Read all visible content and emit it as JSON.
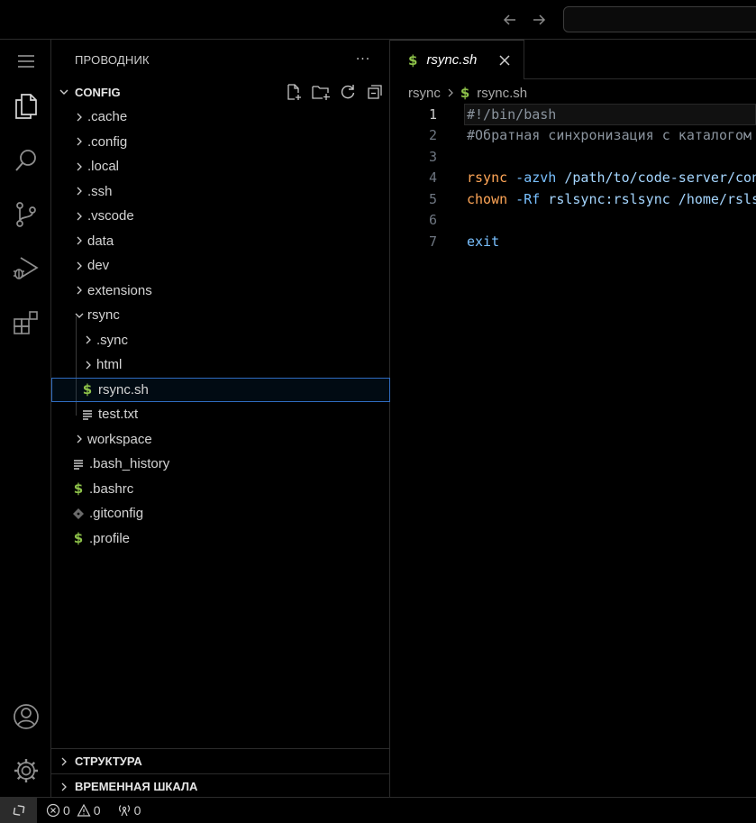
{
  "titlebar": {
    "back_icon": "arrow-left-icon",
    "forward_icon": "arrow-right-icon",
    "search_placeholder": ""
  },
  "activitybar": {
    "items": [
      "menu-icon",
      "files-icon",
      "search-icon",
      "source-control-icon",
      "run-debug-icon",
      "extensions-icon"
    ],
    "bottom": [
      "account-icon",
      "gear-icon"
    ]
  },
  "sidebar": {
    "title": "ПРОВОДНИК",
    "more": "···",
    "folder_name": "CONFIG",
    "tree": [
      {
        "label": ".cache",
        "type": "folder"
      },
      {
        "label": ".config",
        "type": "folder"
      },
      {
        "label": ".local",
        "type": "folder"
      },
      {
        "label": ".ssh",
        "type": "folder"
      },
      {
        "label": ".vscode",
        "type": "folder"
      },
      {
        "label": "data",
        "type": "folder"
      },
      {
        "label": "dev",
        "type": "folder"
      },
      {
        "label": "extensions",
        "type": "folder"
      },
      {
        "label": "rsync",
        "type": "folder-open"
      },
      {
        "label": ".sync",
        "type": "folder"
      },
      {
        "label": "html",
        "type": "folder"
      },
      {
        "label": "rsync.sh",
        "type": "shell"
      },
      {
        "label": "test.txt",
        "type": "text"
      },
      {
        "label": "workspace",
        "type": "folder"
      },
      {
        "label": ".bash_history",
        "type": "text"
      },
      {
        "label": ".bashrc",
        "type": "shell"
      },
      {
        "label": ".gitconfig",
        "type": "git"
      },
      {
        "label": ".profile",
        "type": "shell"
      }
    ],
    "outline_label": "СТРУКТУРА",
    "timeline_label": "ВРЕМЕННАЯ ШКАЛА"
  },
  "editor": {
    "tab_label": "rsync.sh",
    "breadcrumb_folder": "rsync",
    "breadcrumb_file": "rsync.sh",
    "lines": [
      {
        "n": "1",
        "segments": [
          {
            "t": "#!/bin/bash",
            "c": "comment"
          }
        ]
      },
      {
        "n": "2",
        "segments": [
          {
            "t": "#Обратная синхронизация с каталогом",
            "c": "comment"
          }
        ]
      },
      {
        "n": "3",
        "segments": []
      },
      {
        "n": "4",
        "segments": [
          {
            "t": "rsync",
            "c": "cmd"
          },
          {
            "t": " -azvh",
            "c": "flag"
          },
          {
            "t": " /path/to/code-server/config",
            "c": "plain"
          }
        ]
      },
      {
        "n": "5",
        "segments": [
          {
            "t": "chown",
            "c": "cmd"
          },
          {
            "t": " -Rf",
            "c": "flag"
          },
          {
            "t": " rslsync:rslsync /home/rslsync",
            "c": "plain"
          }
        ]
      },
      {
        "n": "6",
        "segments": []
      },
      {
        "n": "7",
        "segments": [
          {
            "t": "exit",
            "c": "exit"
          }
        ]
      }
    ]
  },
  "statusbar": {
    "errors": "0",
    "warnings": "0",
    "ports": "0"
  },
  "colors": {
    "shell_icon": "#8dc149",
    "selection_border": "#2f6cc0"
  }
}
